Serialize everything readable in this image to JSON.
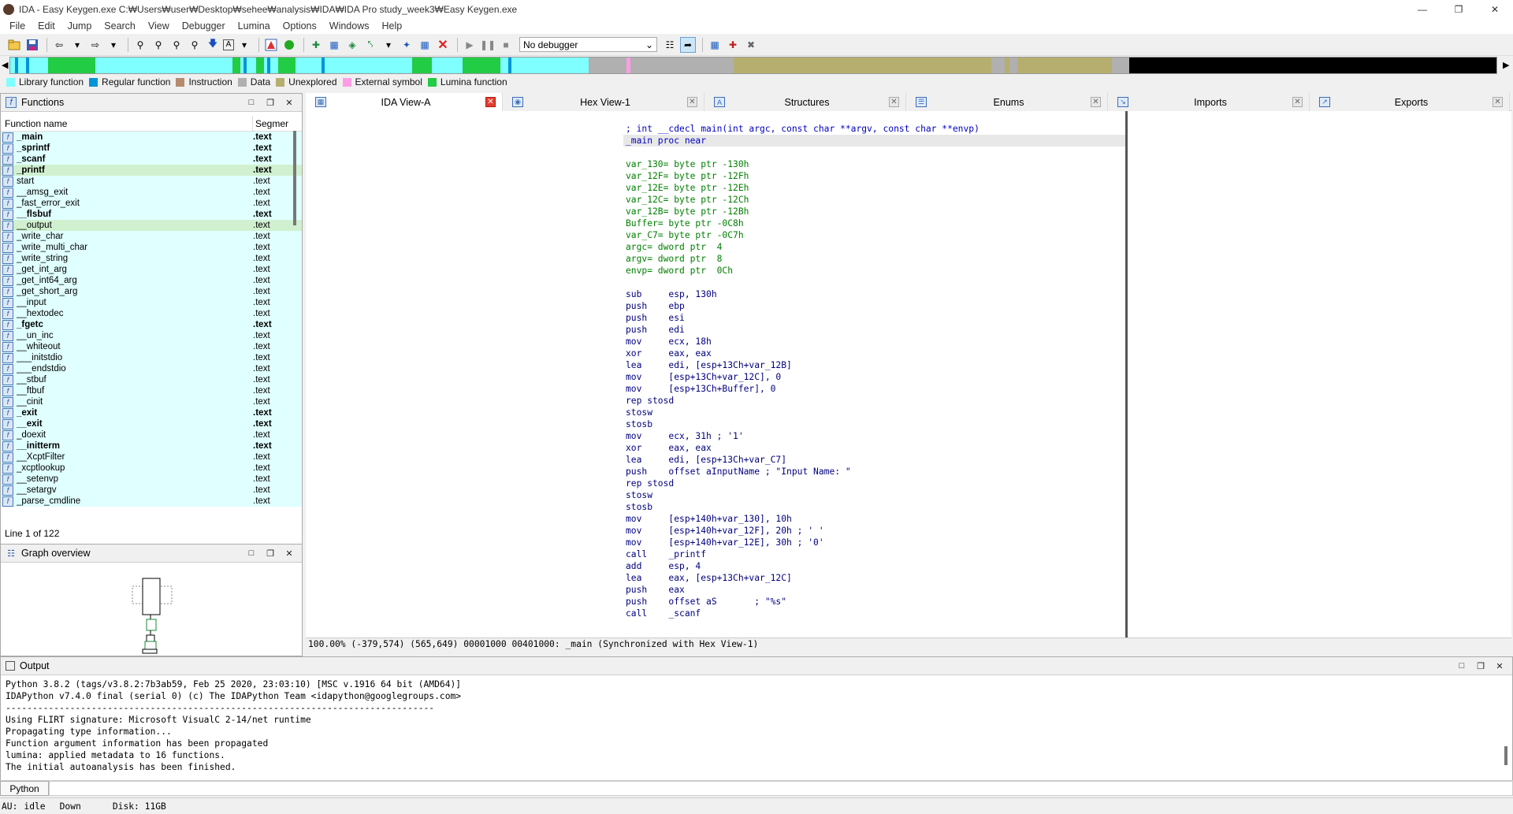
{
  "window": {
    "title": "IDA - Easy Keygen.exe C:₩Users₩user₩Desktop₩sehee₩analysis₩IDA₩IDA Pro study_week3₩Easy Keygen.exe",
    "minimize": "—",
    "restore": "❐",
    "close": "✕"
  },
  "menu": [
    "File",
    "Edit",
    "Jump",
    "Search",
    "View",
    "Debugger",
    "Lumina",
    "Options",
    "Windows",
    "Help"
  ],
  "toolbar": {
    "debugger_select": "No debugger"
  },
  "legend": [
    {
      "label": "Library function",
      "color": "#7fffff"
    },
    {
      "label": "Regular function",
      "color": "#0095d8"
    },
    {
      "label": "Instruction",
      "color": "#b78a6f"
    },
    {
      "label": "Data",
      "color": "#b0b0b0"
    },
    {
      "label": "Unexplored",
      "color": "#b6ae6f"
    },
    {
      "label": "External symbol",
      "color": "#ff9ce6"
    },
    {
      "label": "Lumina function",
      "color": "#22cc44"
    }
  ],
  "tabs": [
    {
      "label": "IDA View-A",
      "active": true
    },
    {
      "label": "Hex View-1",
      "active": false
    },
    {
      "label": "Structures",
      "active": false
    },
    {
      "label": "Enums",
      "active": false
    },
    {
      "label": "Imports",
      "active": false
    },
    {
      "label": "Exports",
      "active": false
    }
  ],
  "functions_panel": {
    "title": "Functions",
    "col_name": "Function name",
    "col_segment": "Segmer",
    "status": "Line 1 of 122",
    "rows": [
      {
        "name": "_main",
        "seg": ".text",
        "bold": true
      },
      {
        "name": "_sprintf",
        "seg": ".text",
        "bold": true
      },
      {
        "name": "_scanf",
        "seg": ".text",
        "bold": true
      },
      {
        "name": "_printf",
        "seg": ".text",
        "bold": true
      },
      {
        "name": "start",
        "seg": ".text",
        "bold": false
      },
      {
        "name": "__amsg_exit",
        "seg": ".text",
        "bold": false
      },
      {
        "name": "_fast_error_exit",
        "seg": ".text",
        "bold": false
      },
      {
        "name": "__flsbuf",
        "seg": ".text",
        "bold": true
      },
      {
        "name": "__output",
        "seg": ".text",
        "bold": false
      },
      {
        "name": "_write_char",
        "seg": ".text",
        "bold": false
      },
      {
        "name": "_write_multi_char",
        "seg": ".text",
        "bold": false
      },
      {
        "name": "_write_string",
        "seg": ".text",
        "bold": false
      },
      {
        "name": "_get_int_arg",
        "seg": ".text",
        "bold": false
      },
      {
        "name": "_get_int64_arg",
        "seg": ".text",
        "bold": false
      },
      {
        "name": "_get_short_arg",
        "seg": ".text",
        "bold": false
      },
      {
        "name": "__input",
        "seg": ".text",
        "bold": false
      },
      {
        "name": "__hextodec",
        "seg": ".text",
        "bold": false
      },
      {
        "name": "_fgetc",
        "seg": ".text",
        "bold": true
      },
      {
        "name": "__un_inc",
        "seg": ".text",
        "bold": false
      },
      {
        "name": "__whiteout",
        "seg": ".text",
        "bold": false
      },
      {
        "name": "___initstdio",
        "seg": ".text",
        "bold": false
      },
      {
        "name": "___endstdio",
        "seg": ".text",
        "bold": false
      },
      {
        "name": "__stbuf",
        "seg": ".text",
        "bold": false
      },
      {
        "name": "__ftbuf",
        "seg": ".text",
        "bold": false
      },
      {
        "name": "__cinit",
        "seg": ".text",
        "bold": false
      },
      {
        "name": "_exit",
        "seg": ".text",
        "bold": true
      },
      {
        "name": "__exit",
        "seg": ".text",
        "bold": true
      },
      {
        "name": "_doexit",
        "seg": ".text",
        "bold": false
      },
      {
        "name": "__initterm",
        "seg": ".text",
        "bold": true
      },
      {
        "name": "__XcptFilter",
        "seg": ".text",
        "bold": false
      },
      {
        "name": "_xcptlookup",
        "seg": ".text",
        "bold": false
      },
      {
        "name": "__setenvp",
        "seg": ".text",
        "bold": false
      },
      {
        "name": "__setargv",
        "seg": ".text",
        "bold": false
      },
      {
        "name": "_parse_cmdline",
        "seg": ".text",
        "bold": false
      }
    ]
  },
  "graph_panel": {
    "title": "Graph overview"
  },
  "ida_view": {
    "lines": [
      {
        "t": ""
      },
      {
        "t": "; int __cdecl main(int argc, const char **argv, const char **envp)",
        "c": "b"
      },
      {
        "t": "_main proc near",
        "c": "b",
        "hl": true
      },
      {
        "t": ""
      },
      {
        "t": "var_130= byte ptr -130h",
        "c": "g"
      },
      {
        "t": "var_12F= byte ptr -12Fh",
        "c": "g"
      },
      {
        "t": "var_12E= byte ptr -12Eh",
        "c": "g"
      },
      {
        "t": "var_12C= byte ptr -12Ch",
        "c": "g"
      },
      {
        "t": "var_12B= byte ptr -12Bh",
        "c": "g"
      },
      {
        "t": "Buffer= byte ptr -0C8h",
        "c": "g"
      },
      {
        "t": "var_C7= byte ptr -0C7h",
        "c": "g"
      },
      {
        "t": "argc= dword ptr  4",
        "c": "g"
      },
      {
        "t": "argv= dword ptr  8",
        "c": "g"
      },
      {
        "t": "envp= dword ptr  0Ch",
        "c": "g"
      },
      {
        "t": ""
      },
      {
        "t": "sub     esp, 130h"
      },
      {
        "t": "push    ebp"
      },
      {
        "t": "push    esi"
      },
      {
        "t": "push    edi"
      },
      {
        "t": "mov     ecx, 18h"
      },
      {
        "t": "xor     eax, eax"
      },
      {
        "t": "lea     edi, [esp+13Ch+var_12B]"
      },
      {
        "t": "mov     [esp+13Ch+var_12C], 0"
      },
      {
        "t": "mov     [esp+13Ch+Buffer], 0"
      },
      {
        "t": "rep stosd"
      },
      {
        "t": "stosw"
      },
      {
        "t": "stosb"
      },
      {
        "t": "mov     ecx, 31h ; '1'"
      },
      {
        "t": "xor     eax, eax"
      },
      {
        "t": "lea     edi, [esp+13Ch+var_C7]"
      },
      {
        "t": "push    offset aInputName ; \"Input Name: \""
      },
      {
        "t": "rep stosd"
      },
      {
        "t": "stosw"
      },
      {
        "t": "stosb"
      },
      {
        "t": "mov     [esp+140h+var_130], 10h"
      },
      {
        "t": "mov     [esp+140h+var_12F], 20h ; ' '"
      },
      {
        "t": "mov     [esp+140h+var_12E], 30h ; '0'"
      },
      {
        "t": "call    _printf"
      },
      {
        "t": "add     esp, 4"
      },
      {
        "t": "lea     eax, [esp+13Ch+var_12C]"
      },
      {
        "t": "push    eax"
      },
      {
        "t": "push    offset aS       ; \"%s\""
      },
      {
        "t": "call    _scanf"
      }
    ],
    "status": "100.00% (-379,574) (565,649) 00001000 00401000: _main (Synchronized with Hex View-1)"
  },
  "output_panel": {
    "title": "Output",
    "text": "Python 3.8.2 (tags/v3.8.2:7b3ab59, Feb 25 2020, 23:03:10) [MSC v.1916 64 bit (AMD64)]\nIDAPython v7.4.0 final (serial 0) (c) The IDAPython Team <idapython@googlegroups.com>\n--------------------------------------------------------------------------------\nUsing FLIRT signature: Microsoft VisualC 2-14/net runtime\nPropagating type information...\nFunction argument information has been propagated\nlumina: applied metadata to 16 functions.\nThe initial autoanalysis has been finished.",
    "python_button": "Python"
  },
  "statusbar": {
    "au": "AU:",
    "state": "idle",
    "dir": "Down",
    "disk": "Disk: 11GB"
  }
}
